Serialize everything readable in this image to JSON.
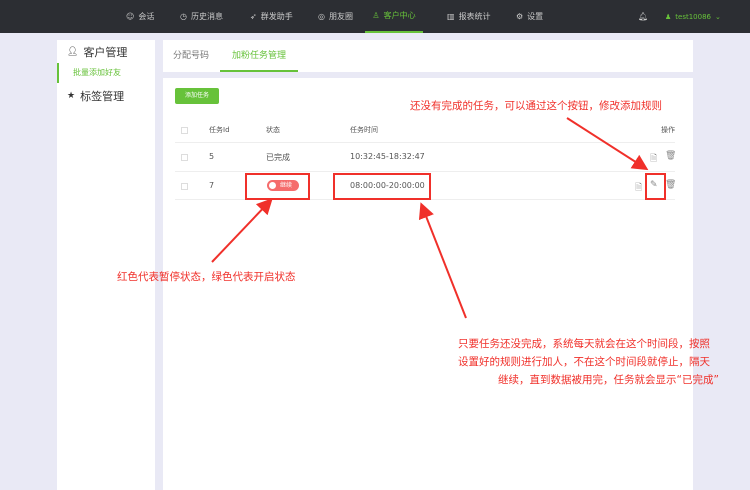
{
  "nav": {
    "items": [
      {
        "label": "会话",
        "icon": "chat-icon"
      },
      {
        "label": "历史消息",
        "icon": "clock-icon"
      },
      {
        "label": "群发助手",
        "icon": "send-icon"
      },
      {
        "label": "朋友圈",
        "icon": "moments-icon"
      },
      {
        "label": "客户中心",
        "icon": "user-icon",
        "active": true
      },
      {
        "label": "报表统计",
        "icon": "bar-chart-icon"
      },
      {
        "label": "设置",
        "icon": "gear-icon"
      }
    ],
    "user": "test10086"
  },
  "sidebar": {
    "group1": "客户管理",
    "group1_item": "批量添加好友",
    "group2": "标签管理"
  },
  "tabs": [
    "分配号码",
    "加粉任务管理"
  ],
  "add_button": "添加任务",
  "table": {
    "headers": [
      "任务Id",
      "状态",
      "任务时间",
      "操作"
    ],
    "rows": [
      {
        "id": "5",
        "status": "已完成",
        "time": "10:32:45-18:32:47"
      },
      {
        "id": "7",
        "status": "继续",
        "time": "08:00:00-20:00:00"
      }
    ]
  },
  "annotations": {
    "a1": "还没有完成的任务，可以通过这个按钮，修改添加规则",
    "a2": "红色代表暂停状态，绿色代表开启状态",
    "a3": [
      "只要任务还没完成，系统每天就会在这个时间段，按照",
      "设置好的规则进行加人，不在这个时间段就停止，隔天",
      "继续，直到数据被用完，任务就会显示“已完成”"
    ]
  },
  "colors": {
    "accent": "#67c23a",
    "annotation": "#f0302a",
    "paused": "#f56c6c"
  }
}
